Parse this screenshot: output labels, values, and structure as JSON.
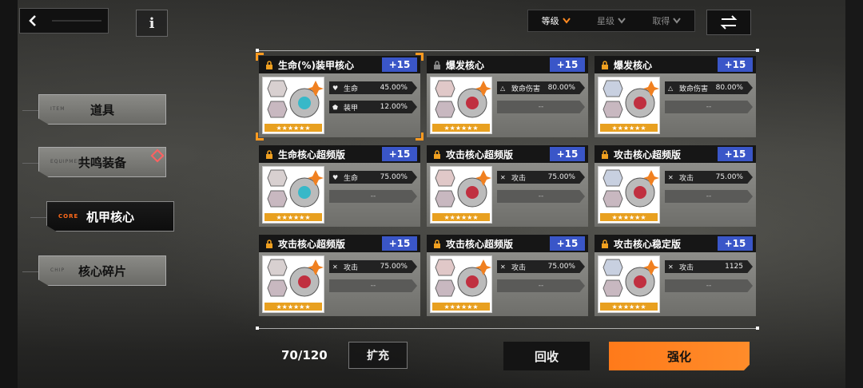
{
  "back": {
    "icon": "back-arrow-icon"
  },
  "info": {
    "label": "i"
  },
  "menu": [
    {
      "en": "ITEM",
      "zh": "道具",
      "active": false
    },
    {
      "en": "EQUIPMENT",
      "zh": "共鸣装备",
      "active": false
    },
    {
      "en": "CORE",
      "zh": "机甲核心",
      "active": true
    },
    {
      "en": "CHIP",
      "zh": "核心碎片",
      "active": false
    }
  ],
  "sort": {
    "options": [
      "等级",
      "星级",
      "取得"
    ],
    "active": "等级"
  },
  "cards": [
    {
      "name": "生命(%)装甲核心",
      "plus": "+15",
      "locked": true,
      "selected": true,
      "stats": [
        {
          "icon": "heart-icon",
          "name": "生命",
          "value": "45.00%"
        },
        {
          "icon": "shield-icon",
          "name": "装甲",
          "value": "12.00%"
        }
      ]
    },
    {
      "name": "爆发核心",
      "plus": "+15",
      "locked": false,
      "selected": false,
      "stats": [
        {
          "icon": "warning-icon",
          "name": "致命伤害",
          "value": "80.00%"
        },
        {
          "empty": "--"
        }
      ]
    },
    {
      "name": "爆发核心",
      "plus": "+15",
      "locked": true,
      "selected": false,
      "stats": [
        {
          "icon": "warning-icon",
          "name": "致命伤害",
          "value": "80.00%"
        },
        {
          "empty": "--"
        }
      ]
    },
    {
      "name": "生命核心超频版",
      "plus": "+15",
      "locked": true,
      "selected": false,
      "stats": [
        {
          "icon": "heart-icon",
          "name": "生命",
          "value": "75.00%"
        },
        {
          "empty": "--"
        }
      ]
    },
    {
      "name": "攻击核心超频版",
      "plus": "+15",
      "locked": true,
      "selected": false,
      "stats": [
        {
          "icon": "swords-icon",
          "name": "攻击",
          "value": "75.00%"
        },
        {
          "empty": "--"
        }
      ]
    },
    {
      "name": "攻击核心超频版",
      "plus": "+15",
      "locked": true,
      "selected": false,
      "stats": [
        {
          "icon": "swords-icon",
          "name": "攻击",
          "value": "75.00%"
        },
        {
          "empty": "--"
        }
      ]
    },
    {
      "name": "攻击核心超频版",
      "plus": "+15",
      "locked": true,
      "selected": false,
      "stats": [
        {
          "icon": "swords-icon",
          "name": "攻击",
          "value": "75.00%"
        },
        {
          "empty": "--"
        }
      ]
    },
    {
      "name": "攻击核心超频版",
      "plus": "+15",
      "locked": true,
      "selected": false,
      "stats": [
        {
          "icon": "swords-icon",
          "name": "攻击",
          "value": "75.00%"
        },
        {
          "empty": "--"
        }
      ]
    },
    {
      "name": "攻击核心稳定版",
      "plus": "+15",
      "locked": true,
      "selected": false,
      "stats": [
        {
          "icon": "swords-icon",
          "name": "攻击",
          "value": "1125"
        },
        {
          "empty": "--"
        }
      ]
    }
  ],
  "capacity": "70/120",
  "buttons": {
    "expand": "扩充",
    "recycle": "回收",
    "enhance": "强化"
  },
  "colors": {
    "accent": "#ff8a20",
    "plus_badge": "#3a56c8"
  }
}
